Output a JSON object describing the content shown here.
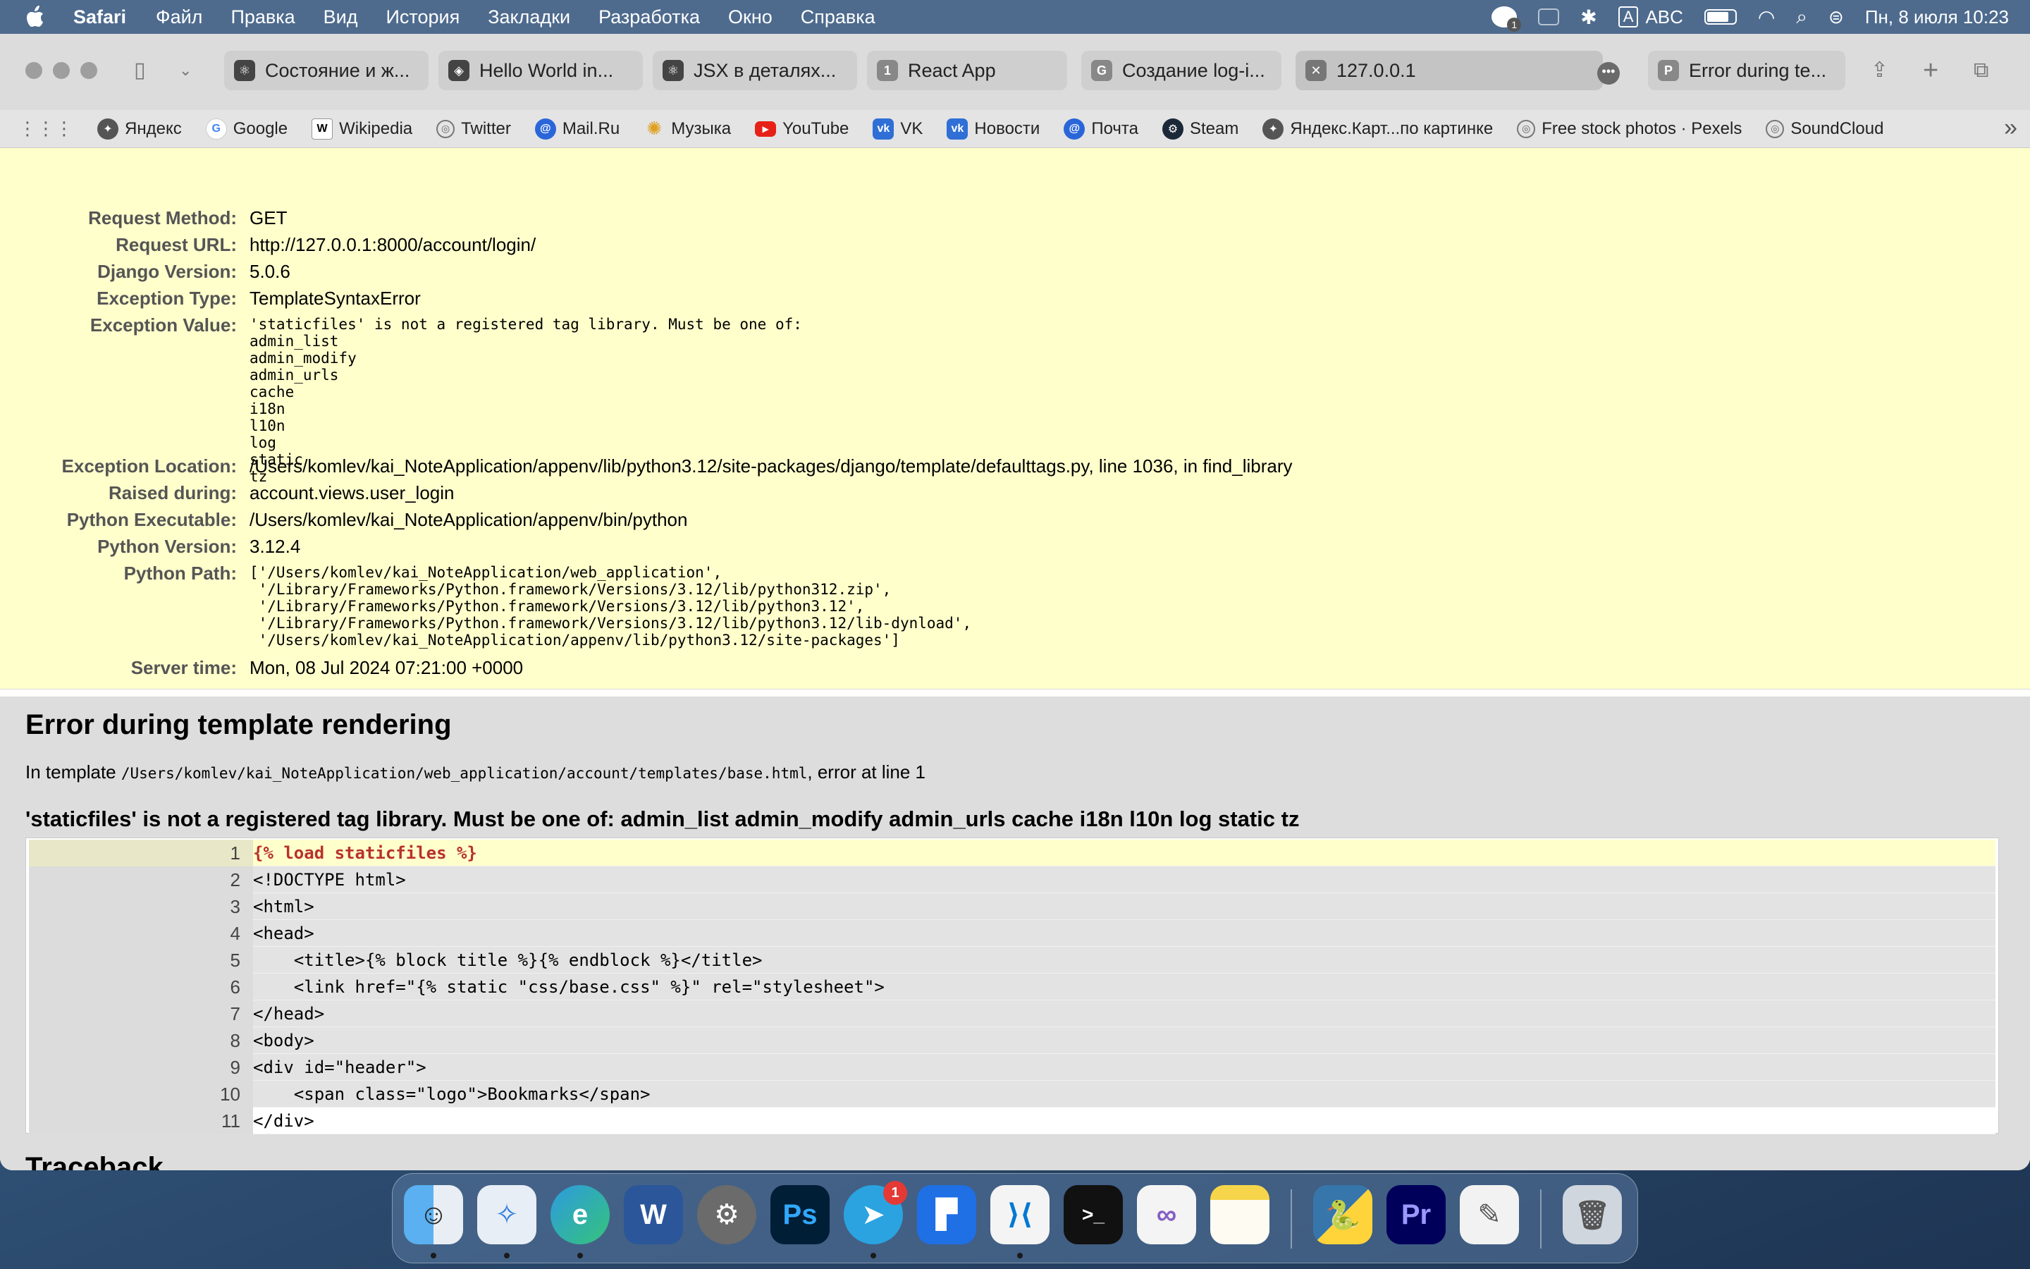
{
  "menubar": {
    "app": "Safari",
    "items": [
      "Файл",
      "Правка",
      "Вид",
      "История",
      "Закладки",
      "Разработка",
      "Окно",
      "Справка"
    ],
    "notif_count": "1",
    "input_source_letter": "A",
    "input_source": "ABC",
    "datetime": "Пн, 8 июля  10:23"
  },
  "tabs": [
    {
      "label": "Состояние и ж...",
      "icon": "react-icon"
    },
    {
      "label": "Hello World in...",
      "icon": "codesandbox-icon"
    },
    {
      "label": "JSX в деталях...",
      "icon": "react-icon"
    },
    {
      "label": "React App",
      "icon": "tab-number-icon",
      "icon_text": "1"
    },
    {
      "label": "Создание log-i...",
      "icon": "tab-letter-icon",
      "icon_text": "G"
    },
    {
      "label": "127.0.0.1",
      "icon": "close-icon"
    },
    {
      "label": "Error during te...",
      "icon": "tab-letter-icon",
      "icon_text": "P"
    }
  ],
  "bookmarks": [
    {
      "label": "Яндекс",
      "icon": "yandex-icon"
    },
    {
      "label": "Google",
      "icon": "google-icon"
    },
    {
      "label": "Wikipedia",
      "icon": "wikipedia-icon"
    },
    {
      "label": "Twitter",
      "icon": "globe-icon"
    },
    {
      "label": "Mail.Ru",
      "icon": "mailru-icon"
    },
    {
      "label": "Музыка",
      "icon": "music-icon"
    },
    {
      "label": "YouTube",
      "icon": "youtube-icon"
    },
    {
      "label": "VK",
      "icon": "vk-icon"
    },
    {
      "label": "Новости",
      "icon": "vk-icon"
    },
    {
      "label": "Почта",
      "icon": "mail-icon"
    },
    {
      "label": "Steam",
      "icon": "steam-icon"
    },
    {
      "label": "Яндекс.Карт...по картинке",
      "icon": "yandex-icon"
    },
    {
      "label": "Free stock photos · Pexels",
      "icon": "globe-icon"
    },
    {
      "label": "SoundCloud",
      "icon": "globe-icon"
    }
  ],
  "summary": [
    {
      "label": "Request Method:",
      "value": "GET"
    },
    {
      "label": "Request URL:",
      "value": "http://127.0.0.1:8000/account/login/"
    },
    {
      "label": "Django Version:",
      "value": "5.0.6"
    },
    {
      "label": "Exception Type:",
      "value": "TemplateSyntaxError"
    },
    {
      "label": "Exception Value:",
      "value": "'staticfiles' is not a registered tag library. Must be one of:\nadmin_list\nadmin_modify\nadmin_urls\ncache\ni18n\nl10n\nlog\nstatic\ntz"
    },
    {
      "label": "Exception Location:",
      "value": "/Users/komlev/kai_NoteApplication/appenv/lib/python3.12/site-packages/django/template/defaulttags.py, line 1036, in find_library"
    },
    {
      "label": "Raised during:",
      "value": "account.views.user_login"
    },
    {
      "label": "Python Executable:",
      "value": "/Users/komlev/kai_NoteApplication/appenv/bin/python"
    },
    {
      "label": "Python Version:",
      "value": "3.12.4"
    },
    {
      "label": "Python Path:",
      "value": "['/Users/komlev/kai_NoteApplication/web_application',\n '/Library/Frameworks/Python.framework/Versions/3.12/lib/python312.zip',\n '/Library/Frameworks/Python.framework/Versions/3.12/lib/python3.12',\n '/Library/Frameworks/Python.framework/Versions/3.12/lib/python3.12/lib-dynload',\n '/Users/komlev/kai_NoteApplication/appenv/lib/python3.12/site-packages']"
    },
    {
      "label": "Server time:",
      "value": "Mon, 08 Jul 2024 07:21:00 +0000"
    }
  ],
  "template": {
    "heading": "Error during template rendering",
    "in_template": "In template ",
    "path": "/Users/komlev/kai_NoteApplication/web_application/account/templates/base.html",
    "error_at": ", error at line 1",
    "message": "'staticfiles' is not a registered tag library. Must be one of: admin_list admin_modify admin_urls cache i18n l10n log static tz",
    "lines": [
      {
        "num": "1",
        "code": "{% load staticfiles %}"
      },
      {
        "num": "2",
        "code": "<!DOCTYPE html>"
      },
      {
        "num": "3",
        "code": "<html>"
      },
      {
        "num": "4",
        "code": "<head>"
      },
      {
        "num": "5",
        "code": "    <title>{% block title %}{% endblock %}</title>"
      },
      {
        "num": "6",
        "code": "    <link href=\"{% static \"css/base.css\" %}\" rel=\"stylesheet\">"
      },
      {
        "num": "7",
        "code": "</head>"
      },
      {
        "num": "8",
        "code": "<body>"
      },
      {
        "num": "9",
        "code": "<div id=\"header\">"
      },
      {
        "num": "10",
        "code": "    <span class=\"logo\">Bookmarks</span>"
      },
      {
        "num": "11",
        "code": "</div>"
      }
    ],
    "next_heading": "Traceback"
  },
  "dock": {
    "telegram_badge": "1",
    "apps": [
      "finder-icon",
      "safari-icon",
      "edge-icon",
      "word-icon",
      "system-settings-icon",
      "photoshop-icon",
      "telegram-icon",
      "whiteboard-icon",
      "vscode-icon",
      "terminal-icon",
      "visual-studio-icon",
      "notes-icon",
      "python-icon",
      "premiere-icon",
      "textedit-icon",
      "trash-icon"
    ],
    "labels": {
      "word": "W",
      "photoshop": "Ps",
      "premiere": "Pr",
      "terminal": ">_"
    }
  }
}
